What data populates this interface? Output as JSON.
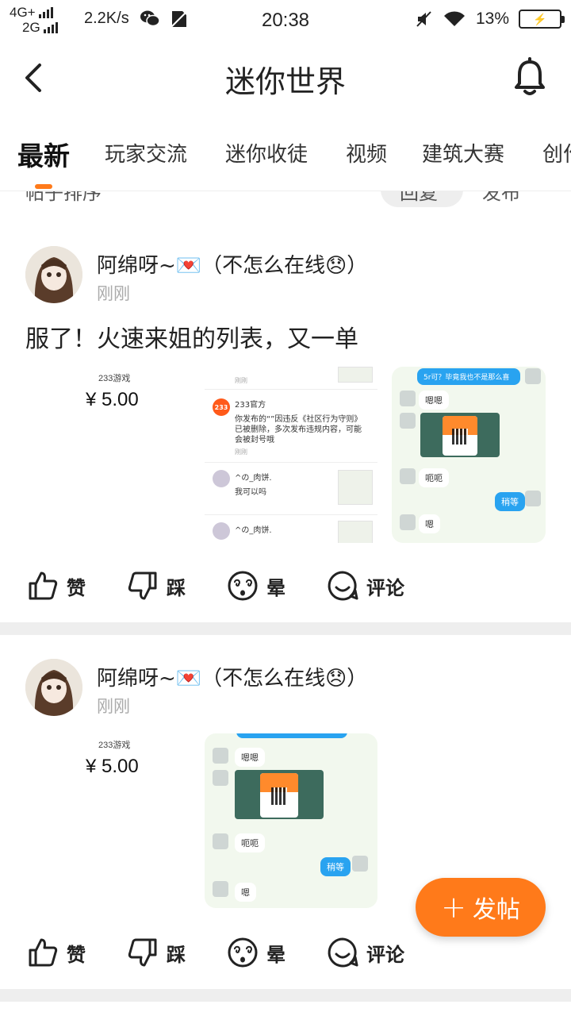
{
  "status_bar": {
    "network_1": "4G+",
    "network_2": "2G",
    "speed": "2.2K/s",
    "time": "20:38",
    "battery": "13%",
    "icons": [
      "signal-icon",
      "wechat-icon",
      "no-sim-icon",
      "mute-icon",
      "wifi-icon",
      "battery-icon"
    ]
  },
  "header": {
    "title": "迷你世界",
    "back_icon": "back-chevron-icon",
    "bell_icon": "bell-icon"
  },
  "tabs": [
    {
      "label": "最新",
      "active": true
    },
    {
      "label": "玩家交流"
    },
    {
      "label": "迷你收徒"
    },
    {
      "label": "视频"
    },
    {
      "label": "建筑大赛"
    },
    {
      "label": "创作"
    }
  ],
  "subbar": {
    "left_text": "帖子排序",
    "pill": "回复",
    "right": "发布"
  },
  "posts": [
    {
      "author": "阿绵呀~💌（不怎么在线😞）",
      "time": "刚刚",
      "text": "服了！火速来姐的列表，又一单",
      "price_brand": "233游戏",
      "price": "¥ 5.00",
      "list_items": [
        {
          "name": "233官方",
          "msg": "你发布的“”因违反《社区行为守则》已被删除，多次发布违规内容，可能会被封号哦",
          "time": "刚刚"
        },
        {
          "name": "^の_肉饼.",
          "msg": "我可以吗",
          "time": ""
        },
        {
          "name": "^の_肉饼.",
          "msg": "",
          "time": ""
        }
      ],
      "chat": {
        "top_bubble": "5r可？毕竟我也不是那么喜",
        "b1": "嗯嗯",
        "b2": "呃呃",
        "b3": "稍等",
        "b4": "嗯"
      }
    },
    {
      "author": "阿绵呀~💌（不怎么在线😞）",
      "time": "刚刚",
      "price_brand": "233游戏",
      "price": "¥ 5.00",
      "chat": {
        "b1": "嗯嗯",
        "b2": "呃呃",
        "b3": "稍等",
        "b4": "嗯"
      }
    }
  ],
  "actions": {
    "like": "赞",
    "dislike": "踩",
    "dizzy": "晕",
    "comment": "评论"
  },
  "fab": {
    "label": "发帖",
    "plus": "+"
  },
  "colors": {
    "accent": "#ff7a1a",
    "chat_blue": "#29a3f0"
  }
}
